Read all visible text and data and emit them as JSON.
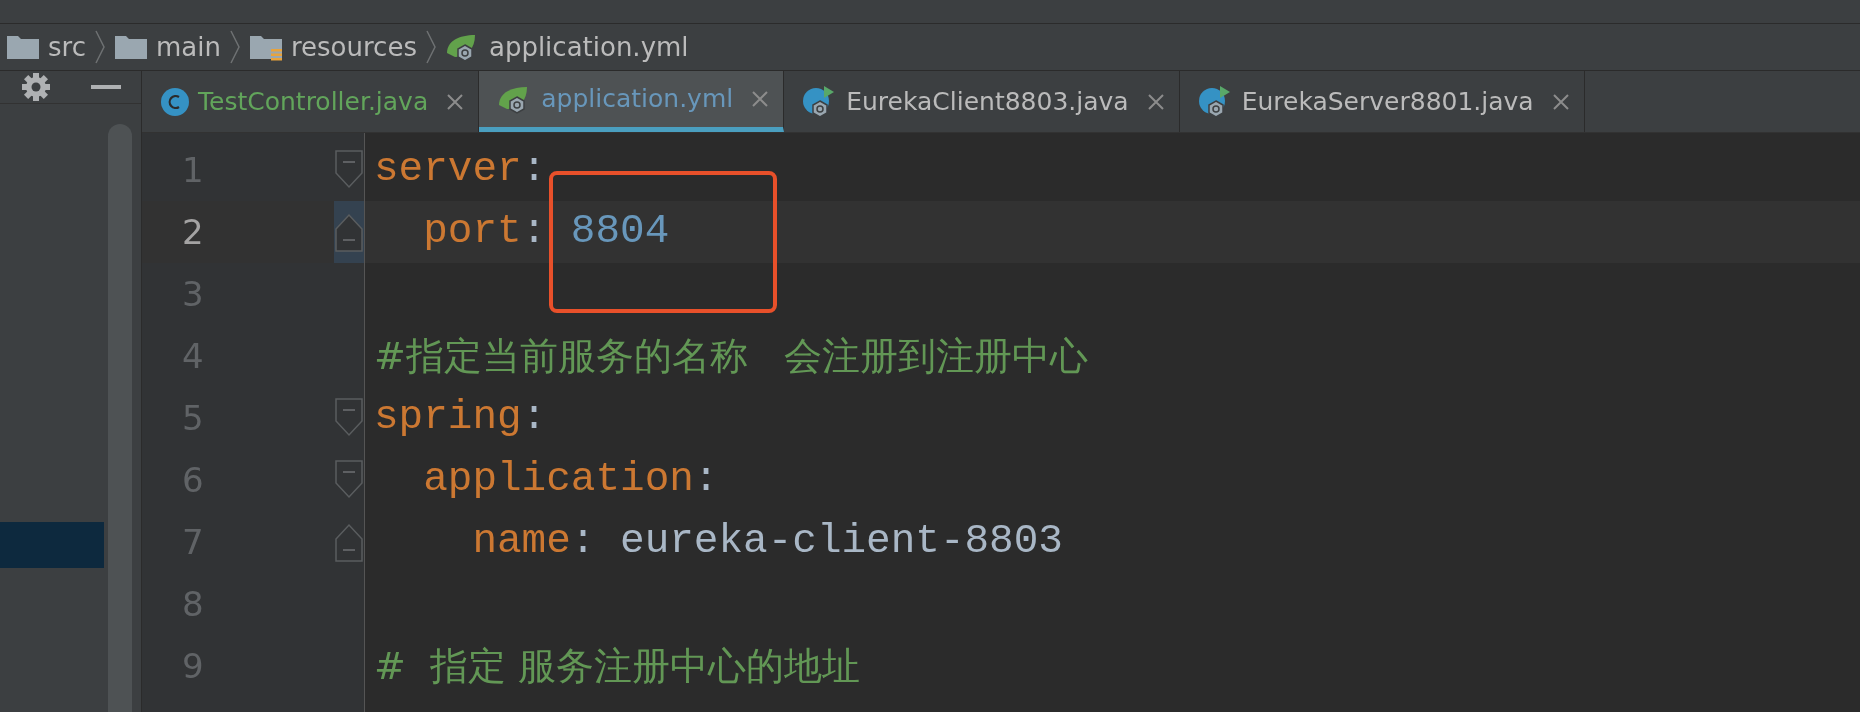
{
  "breadcrumbs": [
    {
      "label": "src",
      "kind": "folder"
    },
    {
      "label": "main",
      "kind": "folder"
    },
    {
      "label": "resources",
      "kind": "resources"
    },
    {
      "label": "application.yml",
      "kind": "spring"
    }
  ],
  "tabs": [
    {
      "label": "TestController.java",
      "kind": "class",
      "color": "#62a55b",
      "selected": false
    },
    {
      "label": "application.yml",
      "kind": "spring",
      "color": "#6897bb",
      "selected": true
    },
    {
      "label": "EurekaClient8803.java",
      "kind": "boot",
      "color": "#bbbbbb",
      "selected": false
    },
    {
      "label": "EurekaServer8801.java",
      "kind": "boot",
      "color": "#bbbbbb",
      "selected": false
    }
  ],
  "lines": [
    {
      "number": "1",
      "current": false,
      "fold_open": true,
      "fold_close": false,
      "tokens": [
        {
          "kind": "key",
          "text": "server"
        },
        {
          "kind": "punct",
          "text": ":"
        }
      ]
    },
    {
      "number": "2",
      "current": true,
      "fold_open": false,
      "fold_close": true,
      "tokens": [
        {
          "kind": "key",
          "text": "  port"
        },
        {
          "kind": "punct",
          "text": ": "
        },
        {
          "kind": "number",
          "text": "8804",
          "annotated": true
        }
      ]
    },
    {
      "number": "3",
      "current": false,
      "fold_open": false,
      "fold_close": false
    },
    {
      "number": "4",
      "current": false,
      "fold_open": false,
      "fold_close": false,
      "tokens": [
        {
          "kind": "comment",
          "text": "#指定当前服务的名称   会注册到注册中心"
        }
      ]
    },
    {
      "number": "5",
      "current": false,
      "fold_open": true,
      "fold_close": false,
      "tokens": [
        {
          "kind": "key",
          "text": "spring"
        },
        {
          "kind": "punct",
          "text": ":"
        }
      ]
    },
    {
      "number": "6",
      "current": false,
      "fold_open": true,
      "fold_close": false,
      "tokens": [
        {
          "kind": "key",
          "text": "  application"
        },
        {
          "kind": "punct",
          "text": ":"
        }
      ]
    },
    {
      "number": "7",
      "current": false,
      "fold_open": false,
      "fold_close": true,
      "tokens": [
        {
          "kind": "key",
          "text": "    name"
        },
        {
          "kind": "punct",
          "text": ": "
        },
        {
          "kind": "value",
          "text": "eureka-client-8803"
        }
      ]
    },
    {
      "number": "8",
      "current": false,
      "fold_open": false,
      "fold_close": false
    },
    {
      "number": "9",
      "current": false,
      "fold_open": false,
      "fold_close": false,
      "tokens": [
        {
          "kind": "comment",
          "text": "#  指定 服务注册中心的地址"
        }
      ]
    }
  ]
}
